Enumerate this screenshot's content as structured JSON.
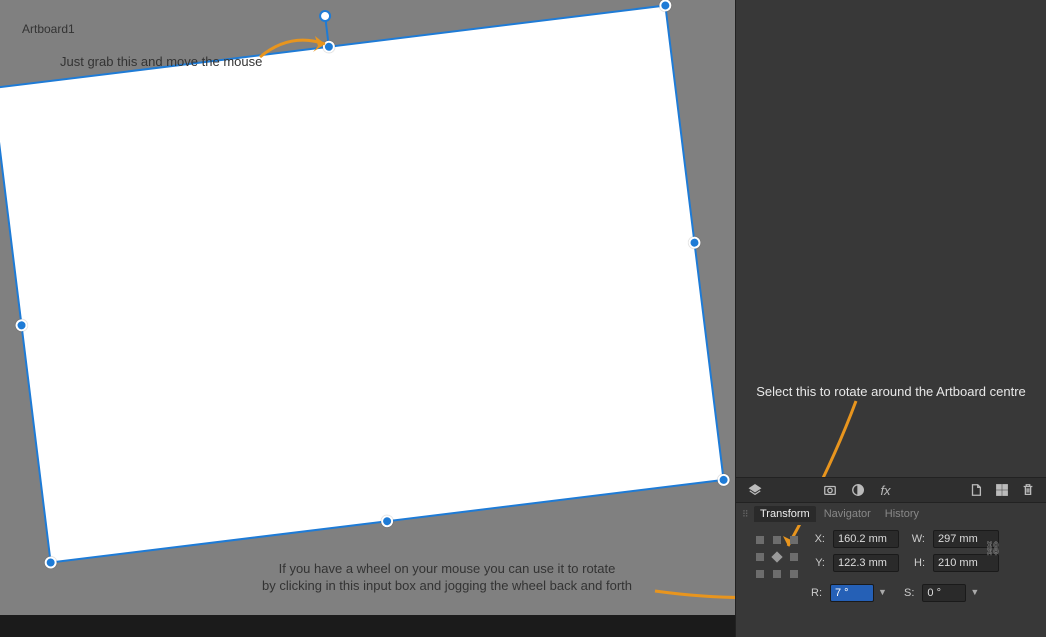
{
  "canvas": {
    "artboard_label": "Artboard1",
    "annotation_top": "Just grab this and move the mouse",
    "annotation_bottom_line1": "If you have a wheel on your mouse you can use it to rotate",
    "annotation_bottom_line2": "by clicking in this input box and jogging the wheel back and forth"
  },
  "right_annotation": "Select this to rotate around the Artboard centre",
  "tabs": {
    "transform": "Transform",
    "navigator": "Navigator",
    "history": "History"
  },
  "transform": {
    "x_label": "X:",
    "x_value": "160.2 mm",
    "y_label": "Y:",
    "y_value": "122.3 mm",
    "w_label": "W:",
    "w_value": "297 mm",
    "h_label": "H:",
    "h_value": "210 mm",
    "r_label": "R:",
    "r_value": "7 °",
    "s_label": "S:",
    "s_value": "0 °"
  }
}
